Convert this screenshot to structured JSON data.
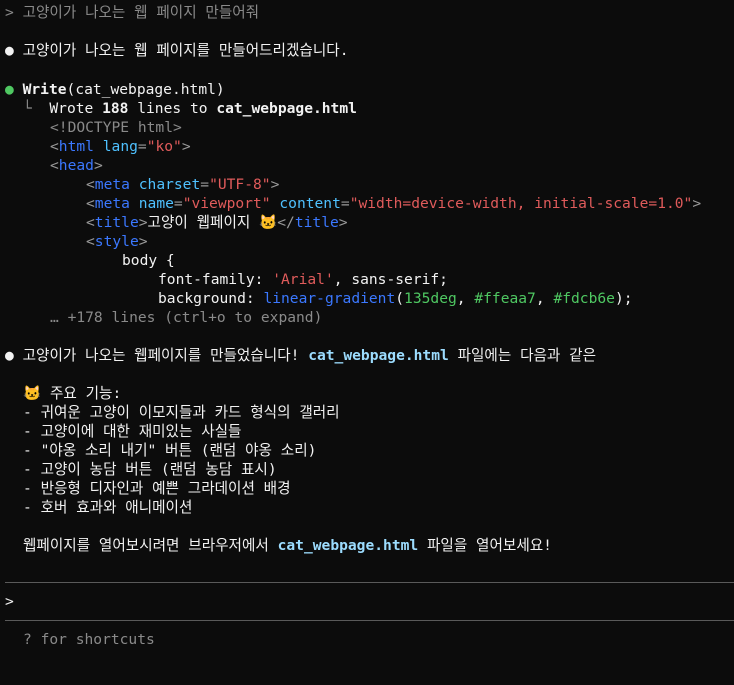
{
  "prompt_line": "> 고양이가 나오는 웹 페이지 만들어줘",
  "assistant_intro": "고양이가 나오는 웹 페이지를 만들어드리겠습니다.",
  "tool_call": {
    "name": "Write",
    "arg": "(cat_webpage.html)",
    "result_prefix": "Wrote ",
    "result_count": "188",
    "result_mid": " lines to ",
    "result_file": "cat_webpage.html",
    "expand_hint": "… +178 lines (ctrl+o to expand)"
  },
  "code": {
    "doctype": "<!DOCTYPE html>",
    "html_open_tag": "html",
    "html_attr": "lang",
    "html_attr_val": "\"ko\"",
    "head_tag": "head",
    "meta_tag": "meta",
    "charset_attr": "charset",
    "charset_val": "\"UTF-8\"",
    "name_attr": "name",
    "name_val": "\"viewport\"",
    "content_attr": "content",
    "content_val": "\"width=device-width, initial-scale=1.0\"",
    "title_tag": "title",
    "title_text": "고양이 웹페이지 ",
    "title_emoji": "🐱",
    "title_close": "title",
    "style_tag": "style",
    "body_selector": "body {",
    "font_prop": "font-family",
    "font_val_str": "'Arial'",
    "font_val_rest": ", sans-serif;",
    "bg_prop": "background",
    "bg_fn": "linear-gradient",
    "bg_deg": "135deg",
    "bg_c1": "#ffeaa7",
    "bg_c2": "#fdcb6e"
  },
  "summary": {
    "lead": "고양이가 나오는 웹페이지를 만들었습니다! ",
    "file": "cat_webpage.html",
    "tail": " 파일에는 다음과 같은",
    "features_emoji": "🐱",
    "features_title": " 주요 기능:",
    "features": [
      "- 귀여운 고양이 이모지들과 카드 형식의 갤러리",
      "- 고양이에 대한 재미있는 사실들",
      "- \"야옹 소리 내기\" 버튼 (랜덤 야옹 소리)",
      "- 고양이 농담 버튼 (랜덤 농담 표시)",
      "- 반응형 디자인과 예쁜 그라데이션 배경",
      "- 호버 효과와 애니메이션"
    ],
    "closing_lead": "웹페이지를 열어보시려면 브라우저에서 ",
    "closing_file": "cat_webpage.html",
    "closing_tail": " 파일을 열어보세요!"
  },
  "input": {
    "prompt": ">",
    "hint": "? for shortcuts"
  },
  "colors": {
    "background": "#0c0c0c",
    "bullet_green": "#4fc862",
    "file_highlight": "#9cdcfe"
  }
}
